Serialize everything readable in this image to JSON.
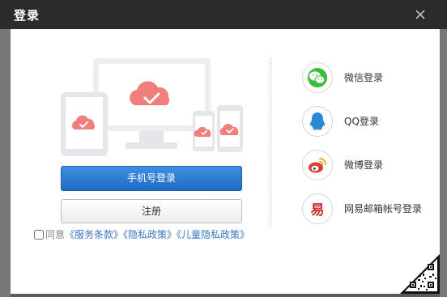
{
  "dialog": {
    "title": "登录",
    "close_icon": "close-icon"
  },
  "buttons": {
    "phone_login": "手机号登录",
    "register": "注册"
  },
  "social_logins": [
    {
      "label": "微信登录",
      "icon": "wechat-icon",
      "color": "#3dbb3a"
    },
    {
      "label": "QQ登录",
      "icon": "qq-icon",
      "color": "#2b8ad6"
    },
    {
      "label": "微博登录",
      "icon": "weibo-icon",
      "color": "#d9402f"
    },
    {
      "label": "网易邮箱帐号登录",
      "icon": "netease-mail-icon",
      "color": "#c9302c"
    }
  ],
  "agreement": {
    "prefix": "同意",
    "terms": "《服务条款》",
    "privacy": "《隐私政策》",
    "child_privacy": "《儿童隐私政策》"
  },
  "colors": {
    "titlebar": "#2b2b2b",
    "primary": "#2a7ad6",
    "link": "#3a77c4",
    "illustration_accent": "#f07e7a"
  }
}
